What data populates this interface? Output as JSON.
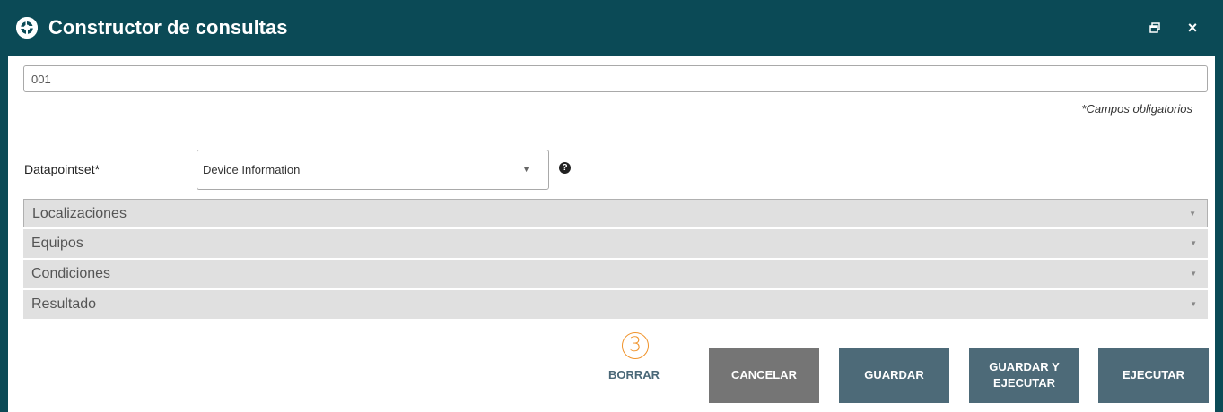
{
  "window": {
    "title": "Constructor de consultas",
    "restore_icon": "restore-window-icon",
    "close_glyph": "×",
    "accent": "#0b4a56"
  },
  "form": {
    "name_value": "001",
    "required_note": "*Campos obligatorios",
    "datapointset_label": "Datapointset*",
    "datapointset_value": "Device Information",
    "help_glyph": "?"
  },
  "sections": [
    {
      "label": "Localizaciones"
    },
    {
      "label": "Equipos"
    },
    {
      "label": "Condiciones"
    },
    {
      "label": "Resultado"
    }
  ],
  "step_marker": "3",
  "actions": {
    "clear": "BORRAR",
    "cancel": "CANCELAR",
    "save": "GUARDAR",
    "save_and_run": "GUARDAR Y\nEJECUTAR",
    "run": "EJECUTAR",
    "button_color": "#4d6a78",
    "cancel_color": "#757575",
    "marker_color": "#f0932b"
  }
}
